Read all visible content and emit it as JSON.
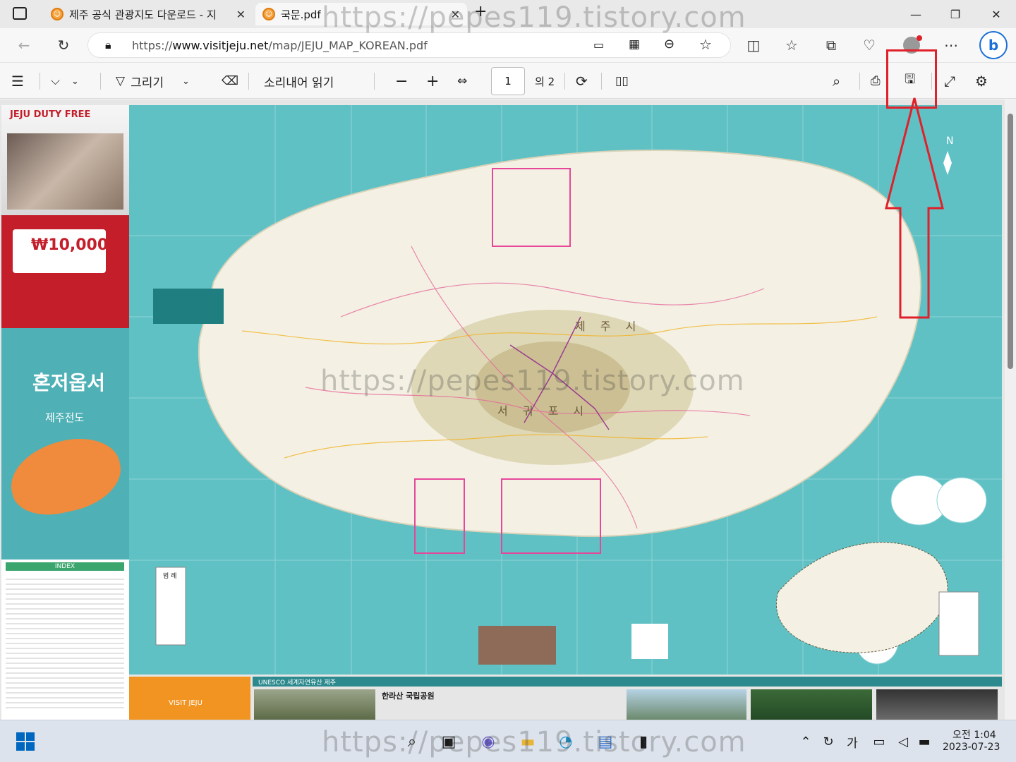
{
  "tabs": [
    {
      "title": "제주 공식 관광지도 다운로드 - 지",
      "close": "✕"
    },
    {
      "title": "국문.pdf",
      "close": "✕"
    }
  ],
  "new_tab": "+",
  "window": {
    "minimize": "—",
    "maximize": "❐",
    "close": "✕"
  },
  "address": {
    "prefix": "https://",
    "host": "www.visitjeju.net",
    "path": "/map/JEJU_MAP_KOREAN.pdf"
  },
  "pdf_toolbar": {
    "draw_label": "그리기",
    "read_aloud_label": "소리내어 읽기",
    "zoom_out": "−",
    "zoom_in": "+",
    "page_current": "1",
    "page_total": "의 2"
  },
  "map": {
    "city_north": "제 주 시",
    "city_south": "서 귀 포 시",
    "sidebar_title": "혼저옵서",
    "sidebar_subtitle": "제주전도",
    "coupon": "₩10,000",
    "duty_free": "JEJU DUTY FREE",
    "unesco": "UNESCO 세계자연유산 제주",
    "hallasan": "한라산 국립공원",
    "visit_jeju": "VISIT JEJU",
    "legend": "범 례",
    "index": "INDEX"
  },
  "watermark": "https://pepes119.tistory.com",
  "taskbar": {
    "time": "오전 1:04",
    "date": "2023-07-23",
    "ime": "가"
  },
  "colors": {
    "highlight": "#e0202a",
    "sea": "#5fc1c4",
    "land": "#f4f1e4",
    "accent": "#0067c0"
  }
}
